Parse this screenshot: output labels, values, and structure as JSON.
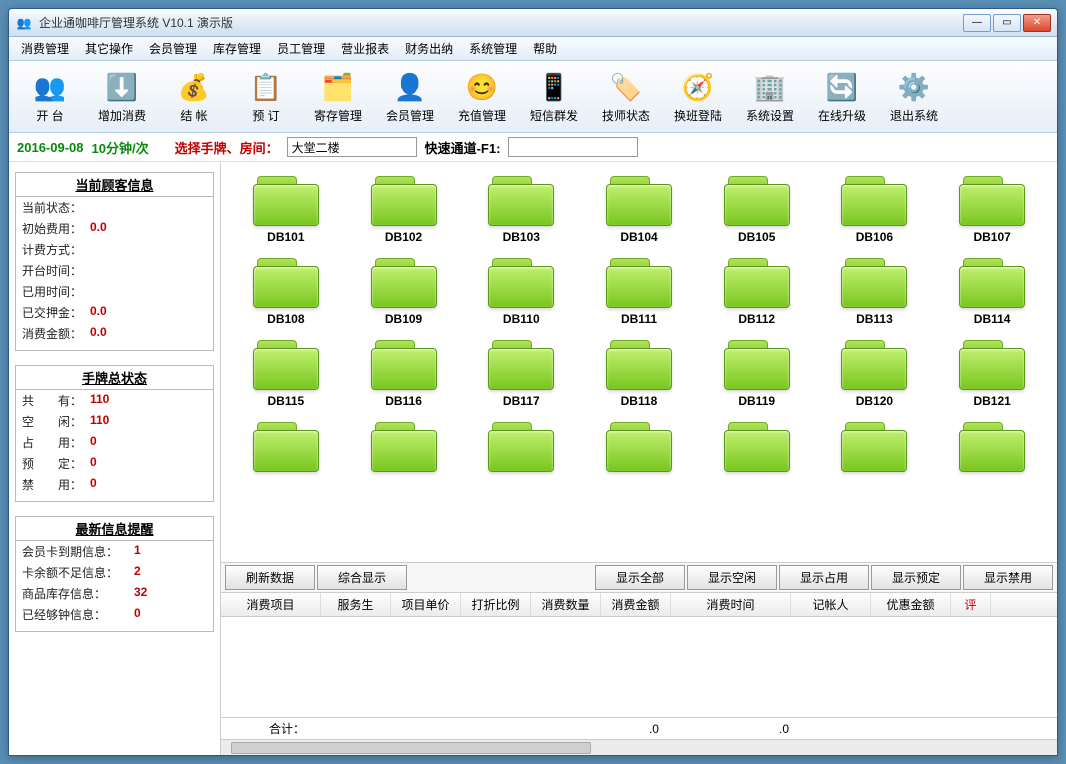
{
  "window": {
    "title": "企业通咖啡厅管理系统 V10.1  演示版"
  },
  "menu": [
    "消费管理",
    "其它操作",
    "会员管理",
    "库存管理",
    "员工管理",
    "营业报表",
    "财务出纳",
    "系统管理",
    "帮助"
  ],
  "toolbar": [
    {
      "label": "开  台",
      "icon": "👥"
    },
    {
      "label": "增加消费",
      "icon": "⬇️"
    },
    {
      "label": "结  帐",
      "icon": "💰"
    },
    {
      "label": "预  订",
      "icon": "📋"
    },
    {
      "label": "寄存管理",
      "icon": "🗂️"
    },
    {
      "label": "会员管理",
      "icon": "👤"
    },
    {
      "label": "充值管理",
      "icon": "😊"
    },
    {
      "label": "短信群发",
      "icon": "📱"
    },
    {
      "label": "技师状态",
      "icon": "🏷️"
    },
    {
      "label": "换班登陆",
      "icon": "🧭"
    },
    {
      "label": "系统设置",
      "icon": "🏢"
    },
    {
      "label": "在线升级",
      "icon": "🔄"
    },
    {
      "label": "退出系统",
      "icon": "⚙️"
    }
  ],
  "filter": {
    "date": "2016-09-08",
    "rate": "10分钟/次",
    "select_label": "选择手牌、房间：",
    "room_value": "大堂二楼",
    "quick_label": "快速通道-F1:",
    "quick_value": ""
  },
  "panels": {
    "customer": {
      "title": "当前顾客信息",
      "rows": [
        {
          "k": "当前状态：",
          "v": ""
        },
        {
          "k": "初始费用：",
          "v": "0.0"
        },
        {
          "k": "计费方式：",
          "v": ""
        },
        {
          "k": "开台时间：",
          "v": ""
        },
        {
          "k": "已用时间：",
          "v": ""
        },
        {
          "k": "已交押金：",
          "v": "0.0"
        },
        {
          "k": "消费金额：",
          "v": "0.0"
        }
      ]
    },
    "cards": {
      "title": "手牌总状态",
      "rows": [
        {
          "k": "共　　有：",
          "v": "110"
        },
        {
          "k": "空　　闲：",
          "v": "110"
        },
        {
          "k": "占　　用：",
          "v": "0"
        },
        {
          "k": "预　　定：",
          "v": "0"
        },
        {
          "k": "禁　　用：",
          "v": "0"
        }
      ]
    },
    "alerts": {
      "title": "最新信息提醒",
      "rows": [
        {
          "k": "会员卡到期信息：",
          "v": "1"
        },
        {
          "k": "卡余额不足信息：",
          "v": "2"
        },
        {
          "k": "商品库存信息：",
          "v": "32"
        },
        {
          "k": "已经够钟信息：",
          "v": "0"
        }
      ]
    }
  },
  "rooms": [
    "DB101",
    "DB102",
    "DB103",
    "DB104",
    "DB105",
    "DB106",
    "DB107",
    "DB108",
    "DB109",
    "DB110",
    "DB111",
    "DB112",
    "DB113",
    "DB114",
    "DB115",
    "DB116",
    "DB117",
    "DB118",
    "DB119",
    "DB120",
    "DB121",
    "",
    "",
    "",
    "",
    "",
    "",
    ""
  ],
  "buttons": [
    "刷新数据",
    "综合显示",
    "显示全部",
    "显示空闲",
    "显示占用",
    "显示预定",
    "显示禁用"
  ],
  "table": {
    "headers": [
      "消费项目",
      "服务生",
      "项目单价",
      "打折比例",
      "消费数量",
      "消费金额",
      "消费时间",
      "记帐人",
      "优惠金额",
      "评"
    ],
    "lastRed": true
  },
  "footer": {
    "sum": "合计：",
    "v1": ".0",
    "v2": ".0"
  }
}
